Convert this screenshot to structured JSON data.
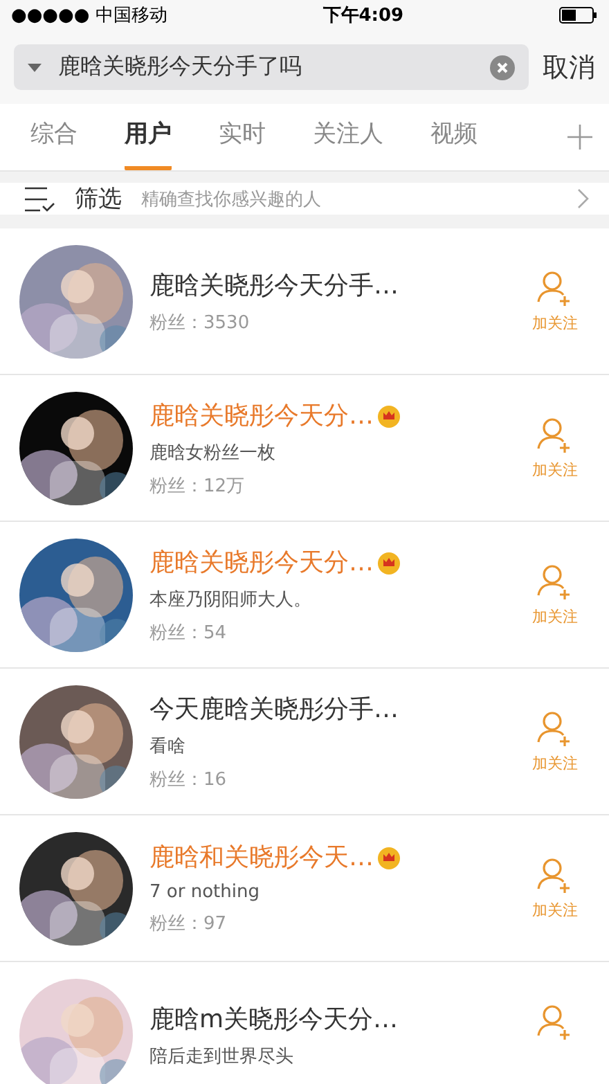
{
  "status_bar": {
    "carrier": "●●●●● 中国移动",
    "time": "下午4:09"
  },
  "search": {
    "value": "鹿晗关晓彤今天分手了吗",
    "cancel": "取消"
  },
  "tabs": [
    {
      "label": "综合",
      "selected": false
    },
    {
      "label": "用户",
      "selected": true
    },
    {
      "label": "实时",
      "selected": false
    },
    {
      "label": "关注人",
      "selected": false
    },
    {
      "label": "视频",
      "selected": false
    }
  ],
  "filter": {
    "label": "筛选",
    "hint": "精确查找你感兴趣的人"
  },
  "users": [
    {
      "name": "鹿晗关晓彤今天分手…",
      "member": false,
      "fans": "粉丝：3530",
      "follow": "加关注"
    },
    {
      "name": "鹿晗关晓彤今天分…",
      "member": true,
      "bio": "鹿晗女粉丝一枚",
      "fans": "粉丝：12万",
      "follow": "加关注"
    },
    {
      "name": "鹿晗关晓彤今天分…",
      "member": true,
      "bio": "本座乃阴阳师大人。",
      "fans": "粉丝：54",
      "follow": "加关注"
    },
    {
      "name": "今天鹿晗关晓彤分手…",
      "member": false,
      "bio": "看啥",
      "fans": "粉丝：16",
      "follow": "加关注"
    },
    {
      "name": "鹿晗和关晓彤今天…",
      "member": true,
      "bio": "7 or nothing",
      "fans": "粉丝：97",
      "follow": "加关注"
    },
    {
      "name": "鹿晗m关晓彤今天分…",
      "member": false,
      "bio": "陪后走到世界尽头"
    }
  ]
}
